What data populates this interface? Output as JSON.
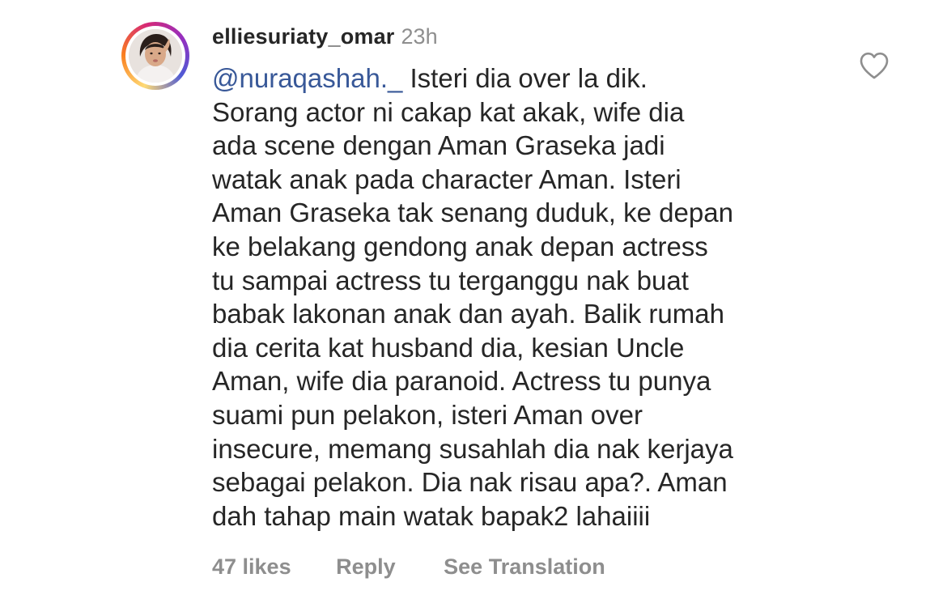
{
  "comment": {
    "username": "elliesuriaty_omar",
    "timestamp": "23h",
    "mention": "@nuraqashah._",
    "text_lines": [
      " Isteri dia over la dik.",
      "Sorang actor ni cakap kat akak, wife dia",
      "ada scene dengan Aman Graseka jadi",
      "watak anak pada character Aman. Isteri",
      "Aman Graseka tak senang duduk, ke depan",
      "ke belakang gendong anak depan actress",
      "tu sampai actress tu terganggu nak buat",
      "babak lakonan anak dan ayah. Balik rumah",
      "dia cerita kat husband dia, kesian Uncle",
      "Aman, wife dia paranoid. Actress tu punya",
      "suami pun pelakon, isteri Aman over",
      "insecure, memang susahlah dia nak kerjaya",
      "sebagai pelakon. Dia nak risau apa?. Aman",
      "dah tahap main watak bapak2 lahaiiii"
    ],
    "likes_label": "47 likes",
    "reply_label": "Reply",
    "translate_label": "See Translation"
  },
  "icons": {
    "like": "heart-outline-icon",
    "avatar": "profile-photo"
  },
  "colors": {
    "text": "#262626",
    "secondary": "#8e8e8e",
    "mention": "#385898",
    "background": "#ffffff"
  }
}
